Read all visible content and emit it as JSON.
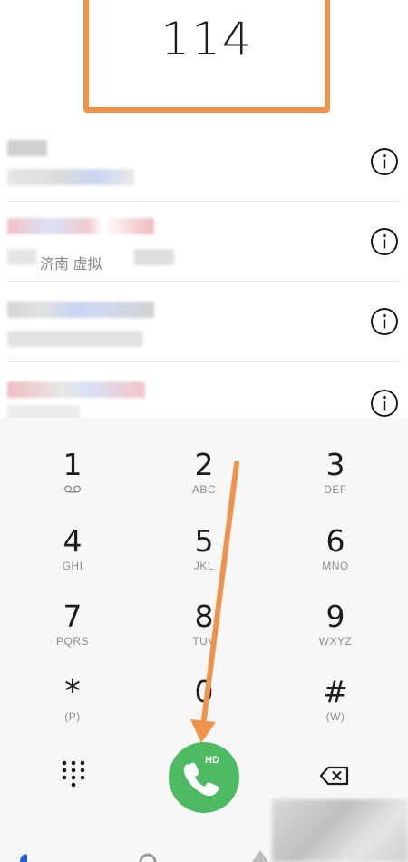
{
  "dialer": {
    "number": "114"
  },
  "contacts": [
    {
      "text": ""
    },
    {
      "text": "济南 虚拟"
    },
    {
      "text": ""
    },
    {
      "text": ""
    }
  ],
  "keypad": {
    "keys": [
      {
        "digit": "1",
        "letters": ""
      },
      {
        "digit": "2",
        "letters": "ABC"
      },
      {
        "digit": "3",
        "letters": "DEF"
      },
      {
        "digit": "4",
        "letters": "GHI"
      },
      {
        "digit": "5",
        "letters": "JKL"
      },
      {
        "digit": "6",
        "letters": "MNO"
      },
      {
        "digit": "7",
        "letters": "PQRS"
      },
      {
        "digit": "8",
        "letters": "TUV"
      },
      {
        "digit": "9",
        "letters": "WXYZ"
      },
      {
        "digit": "*",
        "letters": "(P)"
      },
      {
        "digit": "0",
        "letters": ""
      },
      {
        "digit": "#",
        "letters": "(W)"
      }
    ],
    "call_badge": "HD"
  },
  "colors": {
    "highlight": "#f0934a",
    "call_green": "#4ebb64",
    "keypad_bg": "#f7f7f7"
  },
  "icons": [
    "info-icon",
    "voicemail-icon",
    "dialpad-icon",
    "phone-icon",
    "backspace-icon"
  ]
}
